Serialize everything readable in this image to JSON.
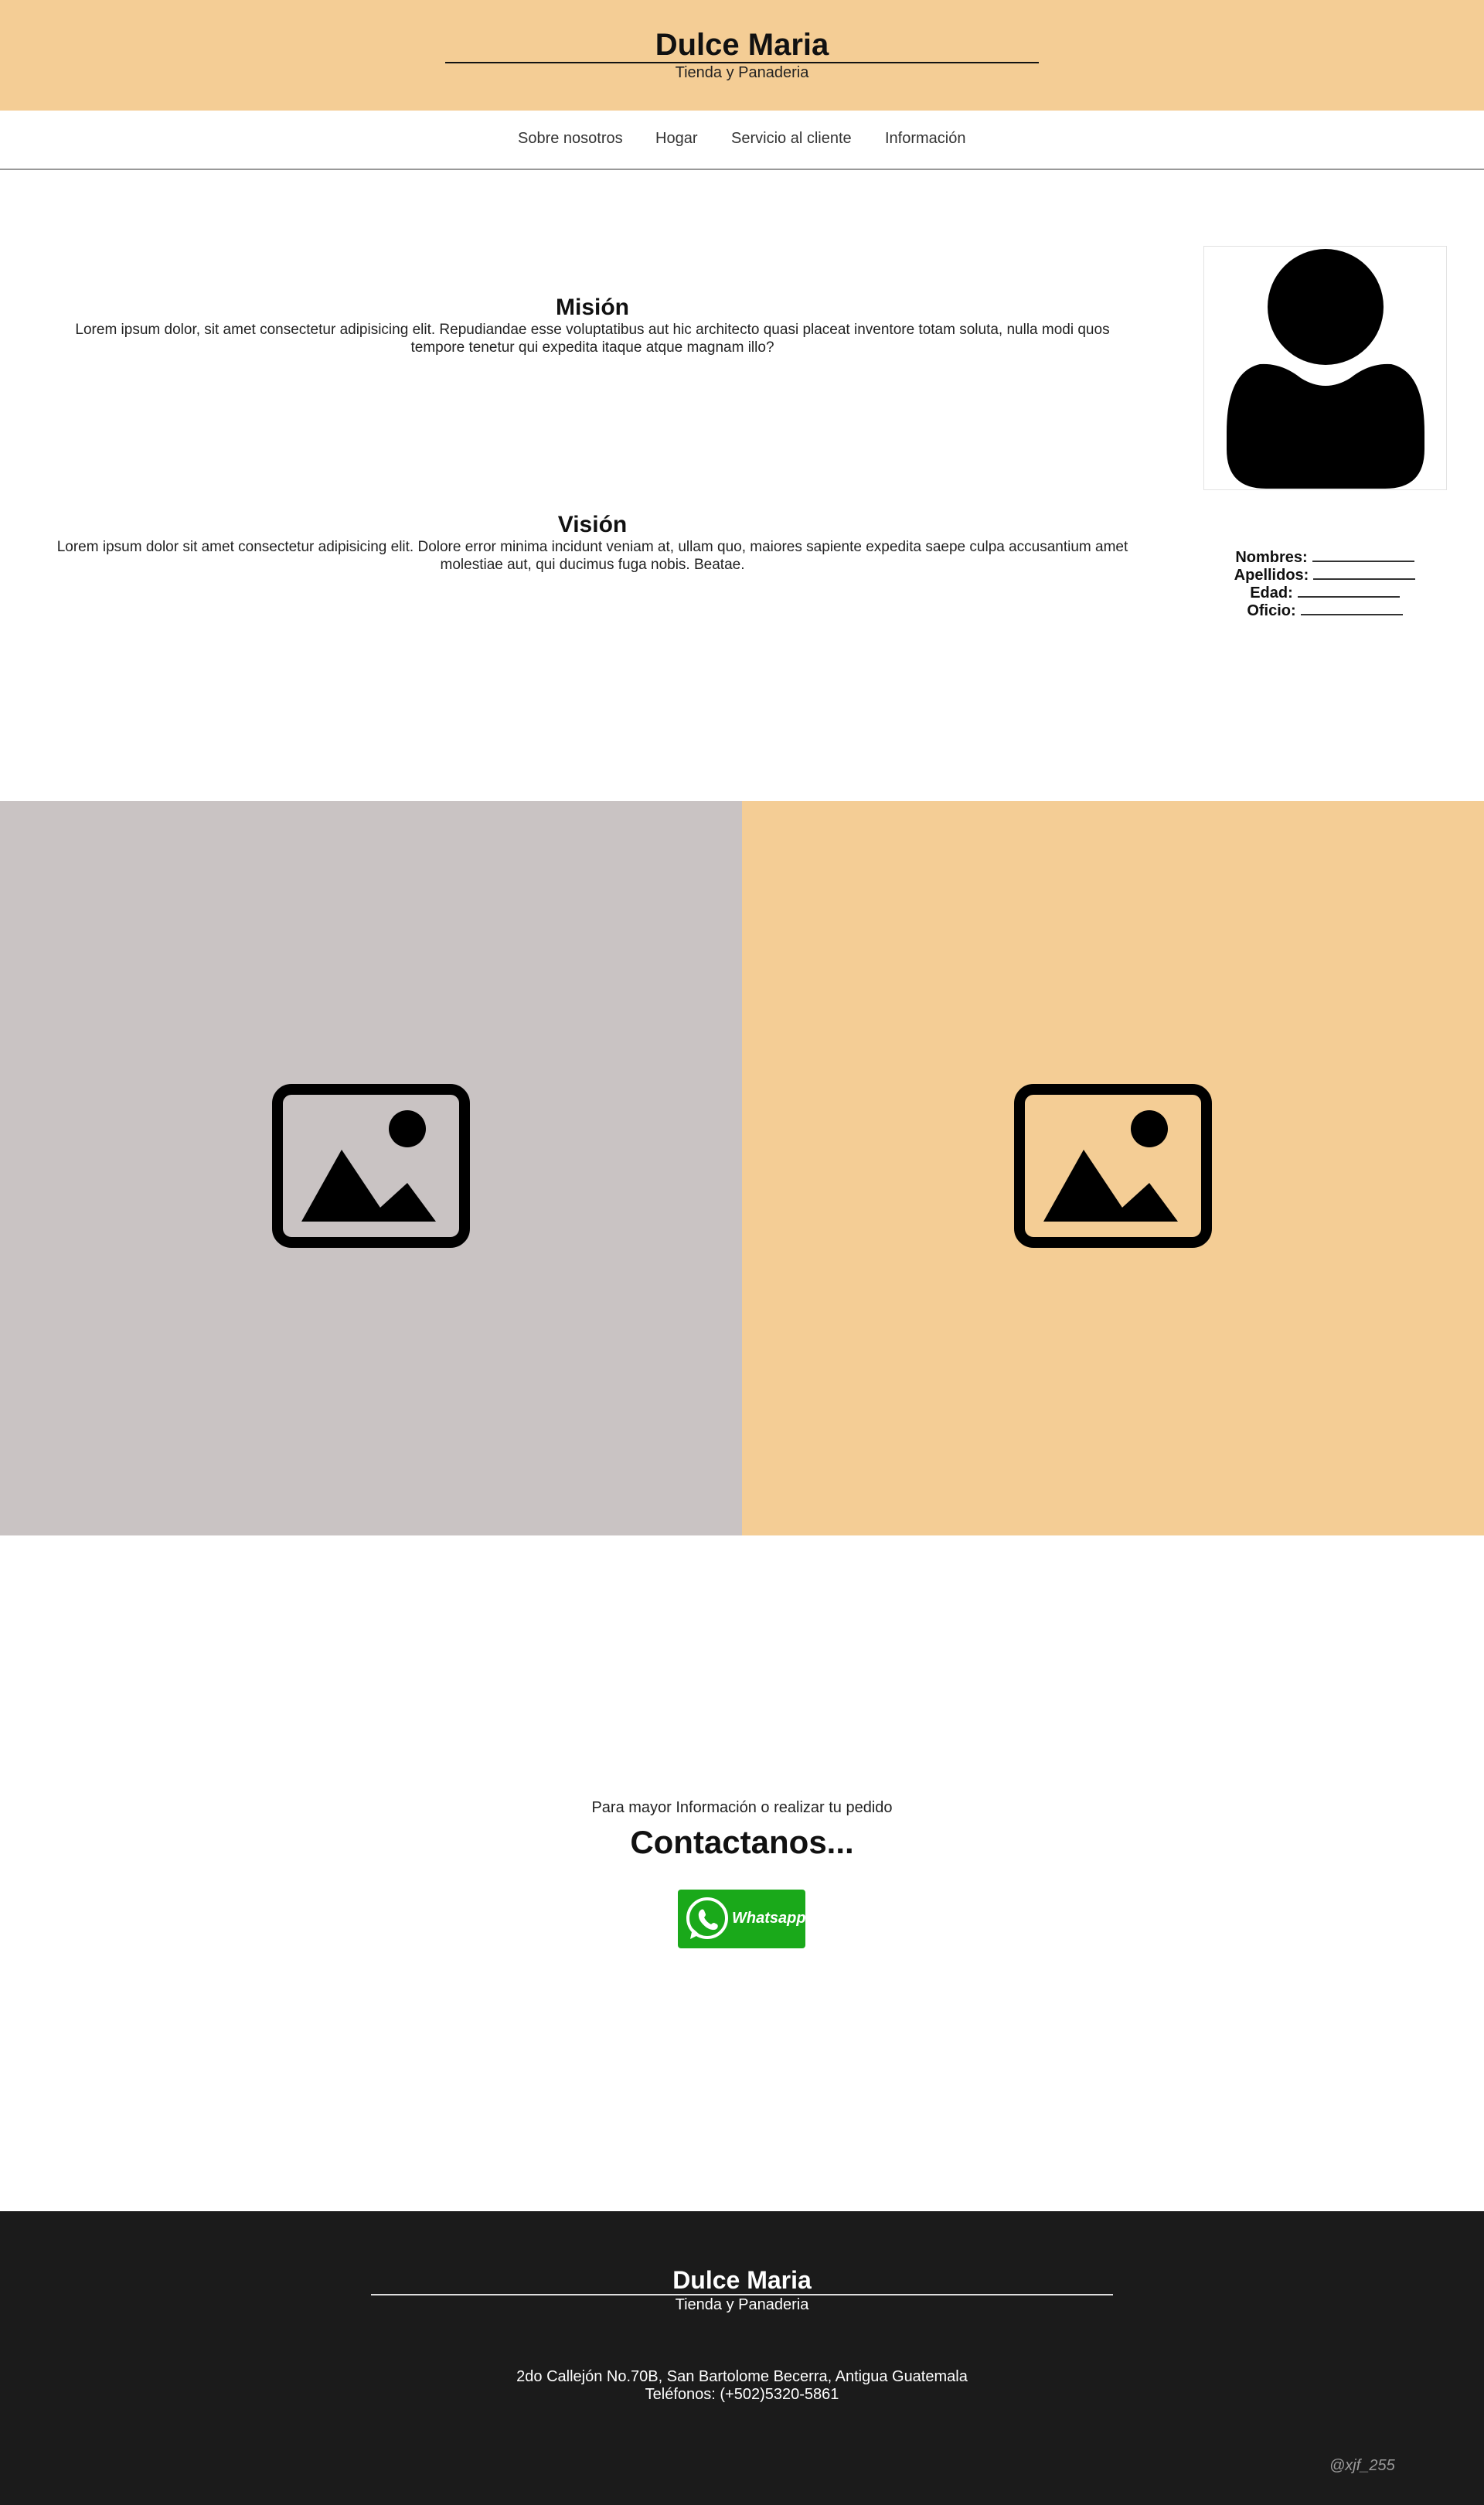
{
  "header": {
    "title": "Dulce Maria",
    "subtitle": "Tienda y Panaderia"
  },
  "nav": {
    "items": [
      {
        "label": "Sobre nosotros"
      },
      {
        "label": "Hogar"
      },
      {
        "label": "Servicio al cliente"
      },
      {
        "label": "Información"
      }
    ]
  },
  "mission": {
    "title": "Misión",
    "text": "Lorem ipsum dolor, sit amet consectetur adipisicing elit. Repudiandae esse voluptatibus aut hic architecto quasi placeat inventore totam soluta, nulla modi quos tempore tenetur qui expedita itaque atque magnam illo?"
  },
  "vision": {
    "title": "Visión",
    "text": "Lorem ipsum dolor sit amet consectetur adipisicing elit. Dolore error minima incidunt veniam at, ullam quo, maiores sapiente expedita saepe culpa accusantium amet molestiae aut, qui ducimus fuga nobis. Beatae."
  },
  "profile": {
    "avatar_icon": "user-avatar-icon",
    "fields": [
      {
        "label": "Nombres:"
      },
      {
        "label": "Apellidos:"
      },
      {
        "label": "Edad:"
      },
      {
        "label": "Oficio:"
      }
    ]
  },
  "gallery": {
    "icon": "image-placeholder-icon",
    "colors": [
      "#c9c3c3",
      "#f4cd95"
    ]
  },
  "contact": {
    "intro": "Para mayor Información o realizar tu pedido",
    "title": "Contactanos...",
    "whatsapp_label": "Whatsapp",
    "whatsapp_color": "#1aa91a"
  },
  "footer": {
    "title": "Dulce Maria",
    "subtitle": "Tienda y Panaderia",
    "address": "2do Callejón No.70B, San Bartolome Becerra, Antigua Guatemala",
    "phones": "Teléfonos: (+502)5320-5861",
    "credit": "@xjf_255"
  },
  "colors": {
    "accent": "#f4cd95",
    "footer_bg": "#1b1b1b"
  }
}
